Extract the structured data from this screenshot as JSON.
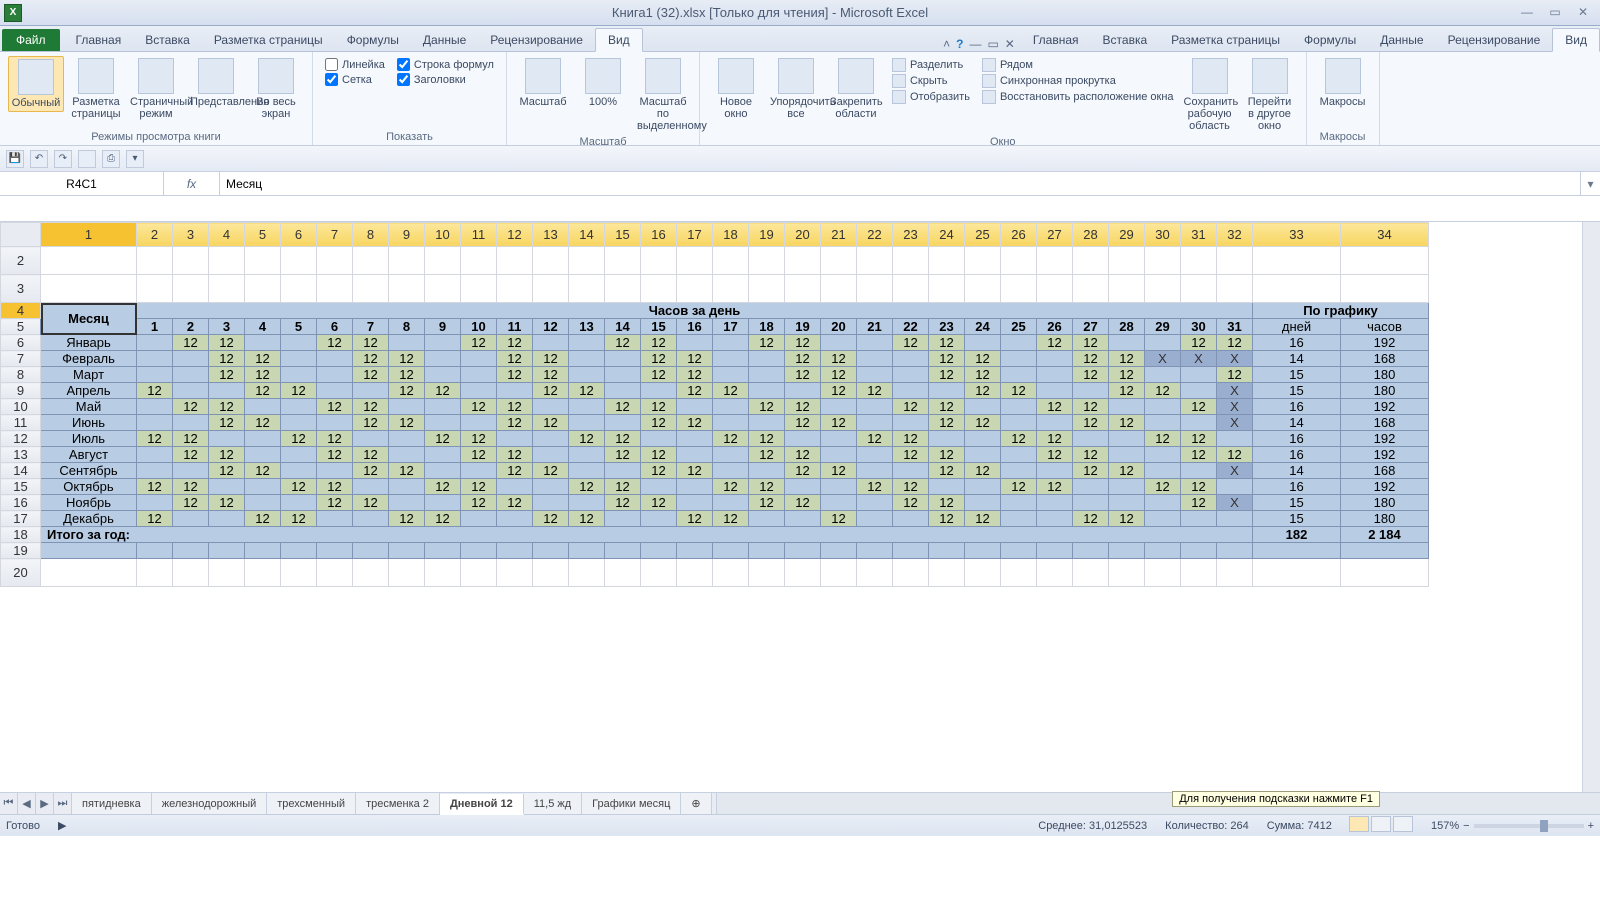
{
  "title": "Книга1 (32).xlsx  [Только для чтения]  -  Microsoft Excel",
  "file_tab": "Файл",
  "tabs": [
    "Главная",
    "Вставка",
    "Разметка страницы",
    "Формулы",
    "Данные",
    "Рецензирование",
    "Вид"
  ],
  "active_tab_index": 6,
  "ribbon": {
    "modes": {
      "label": "Режимы просмотра книги",
      "buttons": [
        "Обычный",
        "Разметка страницы",
        "Страничный режим",
        "Представления",
        "Во весь экран"
      ],
      "selected": 0
    },
    "show": {
      "label": "Показать",
      "checks": [
        {
          "t": "Линейка",
          "c": false
        },
        {
          "t": "Строка формул",
          "c": true
        },
        {
          "t": "Сетка",
          "c": true
        },
        {
          "t": "Заголовки",
          "c": true
        }
      ]
    },
    "zoom": {
      "label": "Масштаб",
      "buttons": [
        "Масштаб",
        "100%",
        "Масштаб по выделенному"
      ]
    },
    "window": {
      "label": "Окно",
      "big": [
        "Новое окно",
        "Упорядочить все",
        "Закрепить области"
      ],
      "small": [
        "Разделить",
        "Скрыть",
        "Отобразить",
        "Рядом",
        "Синхронная прокрутка",
        "Восстановить расположение окна"
      ],
      "big2": [
        "Сохранить рабочую область",
        "Перейти в другое окно"
      ]
    },
    "macros": {
      "label": "Макросы",
      "button": "Макросы"
    }
  },
  "namebox": "R4C1",
  "fx": "fx",
  "formula": "Месяц",
  "col_headers": [
    "1",
    "2",
    "3",
    "4",
    "5",
    "6",
    "7",
    "8",
    "9",
    "10",
    "11",
    "12",
    "13",
    "14",
    "15",
    "16",
    "17",
    "18",
    "19",
    "20",
    "21",
    "22",
    "23",
    "24",
    "25",
    "26",
    "27",
    "28",
    "29",
    "30",
    "31",
    "32",
    "33",
    "34"
  ],
  "row_headers": [
    "2",
    "3",
    "4",
    "5",
    "6",
    "7",
    "8",
    "9",
    "10",
    "11",
    "12",
    "13",
    "14",
    "15",
    "16",
    "17",
    "18",
    "19",
    "20"
  ],
  "table": {
    "month_label": "Месяц",
    "hours_per_day": "Часов за день",
    "by_schedule": "По графику",
    "days_hdr": [
      "1",
      "2",
      "3",
      "4",
      "5",
      "6",
      "7",
      "8",
      "9",
      "10",
      "11",
      "12",
      "13",
      "14",
      "15",
      "16",
      "17",
      "18",
      "19",
      "20",
      "21",
      "22",
      "23",
      "24",
      "25",
      "26",
      "27",
      "28",
      "29",
      "30",
      "31"
    ],
    "sched_hdr": [
      "дней",
      "часов"
    ],
    "months": [
      "Январь",
      "Февраль",
      "Март",
      "Апрель",
      "Май",
      "Июнь",
      "Июль",
      "Август",
      "Сентябрь",
      "Октябрь",
      "Ноябрь",
      "Декабрь"
    ],
    "data": [
      [
        "",
        "12",
        "12",
        "",
        "",
        "12",
        "12",
        "",
        "",
        "12",
        "12",
        "",
        "",
        "12",
        "12",
        "",
        "",
        "12",
        "12",
        "",
        "",
        "12",
        "12",
        "",
        "",
        "12",
        "12",
        "",
        "",
        "12",
        "12"
      ],
      [
        "",
        "",
        "12",
        "12",
        "",
        "",
        "12",
        "12",
        "",
        "",
        "12",
        "12",
        "",
        "",
        "12",
        "12",
        "",
        "",
        "12",
        "12",
        "",
        "",
        "12",
        "12",
        "",
        "",
        "12",
        "12",
        "X",
        "X",
        "X"
      ],
      [
        "",
        "",
        "12",
        "12",
        "",
        "",
        "12",
        "12",
        "",
        "",
        "12",
        "12",
        "",
        "",
        "12",
        "12",
        "",
        "",
        "12",
        "12",
        "",
        "",
        "12",
        "12",
        "",
        "",
        "12",
        "12",
        "",
        "",
        "12"
      ],
      [
        "12",
        "",
        "",
        "12",
        "12",
        "",
        "",
        "12",
        "12",
        "",
        "",
        "12",
        "12",
        "",
        "",
        "12",
        "12",
        "",
        "",
        "12",
        "12",
        "",
        "",
        "12",
        "12",
        "",
        "",
        "12",
        "12",
        "",
        "X"
      ],
      [
        "",
        "12",
        "12",
        "",
        "",
        "12",
        "12",
        "",
        "",
        "12",
        "12",
        "",
        "",
        "12",
        "12",
        "",
        "",
        "12",
        "12",
        "",
        "",
        "12",
        "12",
        "",
        "",
        "12",
        "12",
        "",
        "",
        "12",
        "X"
      ],
      [
        "",
        "",
        "12",
        "12",
        "",
        "",
        "12",
        "12",
        "",
        "",
        "12",
        "12",
        "",
        "",
        "12",
        "12",
        "",
        "",
        "12",
        "12",
        "",
        "",
        "12",
        "12",
        "",
        "",
        "12",
        "12",
        "",
        "",
        "X"
      ],
      [
        "12",
        "12",
        "",
        "",
        "12",
        "12",
        "",
        "",
        "12",
        "12",
        "",
        "",
        "12",
        "12",
        "",
        "",
        "12",
        "12",
        "",
        "",
        "12",
        "12",
        "",
        "",
        "12",
        "12",
        "",
        "",
        "12",
        "12",
        ""
      ],
      [
        "",
        "12",
        "12",
        "",
        "",
        "12",
        "12",
        "",
        "",
        "12",
        "12",
        "",
        "",
        "12",
        "12",
        "",
        "",
        "12",
        "12",
        "",
        "",
        "12",
        "12",
        "",
        "",
        "12",
        "12",
        "",
        "",
        "12",
        "12"
      ],
      [
        "",
        "",
        "12",
        "12",
        "",
        "",
        "12",
        "12",
        "",
        "",
        "12",
        "12",
        "",
        "",
        "12",
        "12",
        "",
        "",
        "12",
        "12",
        "",
        "",
        "12",
        "12",
        "",
        "",
        "12",
        "12",
        "",
        "",
        "X"
      ],
      [
        "12",
        "12",
        "",
        "",
        "12",
        "12",
        "",
        "",
        "12",
        "12",
        "",
        "",
        "12",
        "12",
        "",
        "",
        "12",
        "12",
        "",
        "",
        "12",
        "12",
        "",
        "",
        "12",
        "12",
        "",
        "",
        "12",
        "12",
        ""
      ],
      [
        "",
        "12",
        "12",
        "",
        "",
        "12",
        "12",
        "",
        "",
        "12",
        "12",
        "",
        "",
        "12",
        "12",
        "",
        "",
        "12",
        "12",
        "",
        "",
        "12",
        "12",
        "",
        "",
        "",
        "",
        "",
        "",
        "12",
        "X"
      ],
      [
        "12",
        "",
        "",
        "12",
        "12",
        "",
        "",
        "12",
        "12",
        "",
        "",
        "12",
        "12",
        "",
        "",
        "12",
        "12",
        "",
        "",
        "12",
        "",
        "",
        "12",
        "12",
        "",
        "",
        "12",
        "12",
        "",
        "",
        ""
      ]
    ],
    "sched": [
      [
        "16",
        "192"
      ],
      [
        "14",
        "168"
      ],
      [
        "15",
        "180"
      ],
      [
        "15",
        "180"
      ],
      [
        "16",
        "192"
      ],
      [
        "14",
        "168"
      ],
      [
        "16",
        "192"
      ],
      [
        "16",
        "192"
      ],
      [
        "14",
        "168"
      ],
      [
        "16",
        "192"
      ],
      [
        "15",
        "180"
      ],
      [
        "15",
        "180"
      ]
    ],
    "total_label": "Итого за год:",
    "total": [
      "182",
      "2 184"
    ]
  },
  "sheet_tabs": [
    "пятидневка",
    "железнодорожный",
    "трехсменный",
    "тресменка 2",
    "Дневной 12",
    "11,5 жд",
    "Графики месяц"
  ],
  "active_sheet": 4,
  "hint": "Для получения подсказки нажмите F1",
  "status": {
    "ready": "Готово",
    "avg": "Среднее: 31,0125523",
    "count": "Количество: 264",
    "sum": "Сумма: 7412",
    "zoom": "157%"
  }
}
